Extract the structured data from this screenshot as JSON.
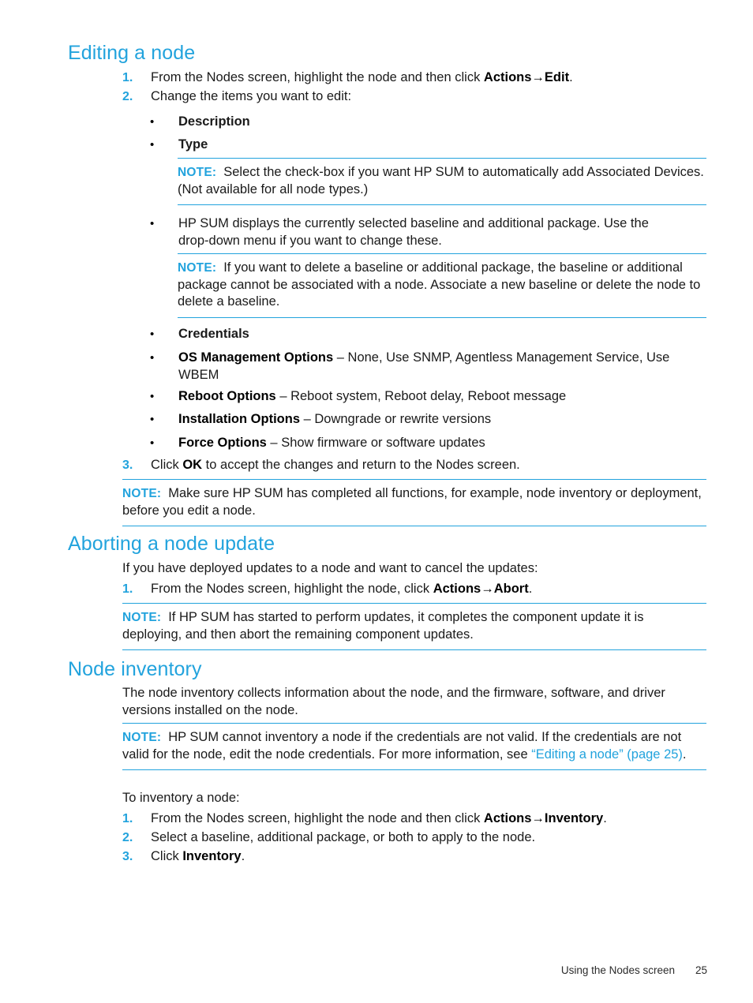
{
  "colors": {
    "heading_blue": "#22A3DD",
    "note_rule": "#22A3DD",
    "body_text": "#1a1a1a"
  },
  "sections": [
    {
      "id": "editing-a-node",
      "heading": "Editing a node",
      "steps": [
        {
          "num": "1.",
          "parts": [
            {
              "t": "From the Nodes screen, highlight the node and then click ",
              "s": "normal"
            },
            {
              "t": "Actions→Edit",
              "s": "bold"
            },
            {
              "t": ".",
              "s": "normal"
            }
          ]
        },
        {
          "num": "2.",
          "parts": [
            {
              "t": "Change the items you want to edit:",
              "s": "normal"
            }
          ]
        },
        {
          "num": "3.",
          "parts": [
            {
              "t": "Click ",
              "s": "normal"
            },
            {
              "t": "OK",
              "s": "bold"
            },
            {
              "t": " to accept the changes and return to the Nodes screen.",
              "s": "normal"
            }
          ]
        }
      ],
      "bullets": [
        {
          "parts": [
            {
              "t": "Description",
              "s": "bold"
            }
          ]
        },
        {
          "parts": [
            {
              "t": "Type",
              "s": "bold"
            }
          ]
        },
        {
          "parts": [
            {
              "t": "HP SUM displays the currently selected baseline and additional package. Use the drop-down menu if you want to change these.",
              "s": "normal"
            }
          ]
        },
        {
          "parts": [
            {
              "t": "Credentials",
              "s": "bold"
            }
          ]
        },
        {
          "parts": [
            {
              "t": "OS Management Options",
              "s": "bold"
            },
            {
              "t": " – None, Use SNMP, Agentless Management Service, Use WBEM",
              "s": "normal"
            }
          ]
        },
        {
          "parts": [
            {
              "t": "Reboot Options",
              "s": "bold"
            },
            {
              "t": " – Reboot system, Reboot delay, Reboot message",
              "s": "normal"
            }
          ]
        },
        {
          "parts": [
            {
              "t": "Installation Options",
              "s": "bold"
            },
            {
              "t": " – Downgrade or rewrite versions",
              "s": "normal"
            }
          ]
        },
        {
          "parts": [
            {
              "t": "Force Options",
              "s": "bold"
            },
            {
              "t": " – Show firmware or software updates",
              "s": "normal"
            }
          ]
        }
      ],
      "notes": [
        {
          "label": "NOTE:",
          "parts": [
            {
              "t": "Select the check-box if you want HP SUM to automatically add Associated Devices. (Not available for all node types.)",
              "s": "normal"
            }
          ]
        },
        {
          "label": "NOTE:",
          "parts": [
            {
              "t": "If you want to delete a baseline or additional package, the baseline or additional package cannot be associated with a node. Associate a new baseline or delete the node to delete a baseline.",
              "s": "normal"
            }
          ]
        },
        {
          "label": "NOTE:",
          "parts": [
            {
              "t": "Make sure HP SUM has completed all functions, for example, node inventory or deployment, before you edit a node.",
              "s": "normal"
            }
          ]
        }
      ]
    },
    {
      "id": "aborting-a-node-update",
      "heading": "Aborting a node update",
      "intro": "If you have deployed updates to a node and want to cancel the updates:",
      "steps": [
        {
          "num": "1.",
          "parts": [
            {
              "t": "From the Nodes screen, highlight the node, click ",
              "s": "normal"
            },
            {
              "t": "Actions→Abort",
              "s": "bold"
            },
            {
              "t": ".",
              "s": "normal"
            }
          ]
        }
      ],
      "notes": [
        {
          "label": "NOTE:",
          "parts": [
            {
              "t": "If HP SUM has started to perform updates, it completes the component update it is deploying, and then abort the remaining component updates.",
              "s": "normal"
            }
          ]
        }
      ]
    },
    {
      "id": "node-inventory",
      "heading": "Node inventory",
      "intro": "The node inventory collects information about the node, and the firmware, software, and driver versions installed on the node.",
      "intro2": "To inventory a node:",
      "steps": [
        {
          "num": "1.",
          "parts": [
            {
              "t": "From the Nodes screen, highlight the node and then click ",
              "s": "normal"
            },
            {
              "t": "Actions→Inventory",
              "s": "bold"
            },
            {
              "t": ".",
              "s": "normal"
            }
          ]
        },
        {
          "num": "2.",
          "parts": [
            {
              "t": "Select a baseline, additional package, or both to apply to the node.",
              "s": "normal"
            }
          ]
        },
        {
          "num": "3.",
          "parts": [
            {
              "t": "Click ",
              "s": "normal"
            },
            {
              "t": "Inventory",
              "s": "bold"
            },
            {
              "t": ".",
              "s": "normal"
            }
          ]
        }
      ],
      "notes": [
        {
          "label": "NOTE:",
          "parts": [
            {
              "t": "HP SUM cannot inventory a node if the credentials are not valid. If the credentials are not valid for the node, edit the node credentials. For more information, see ",
              "s": "normal"
            },
            {
              "t": "“Editing a node” (page 25)",
              "s": "link"
            },
            {
              "t": ".",
              "s": "normal"
            }
          ]
        }
      ]
    }
  ],
  "footer": {
    "running_head": "Using the Nodes screen",
    "page_number": "25"
  }
}
